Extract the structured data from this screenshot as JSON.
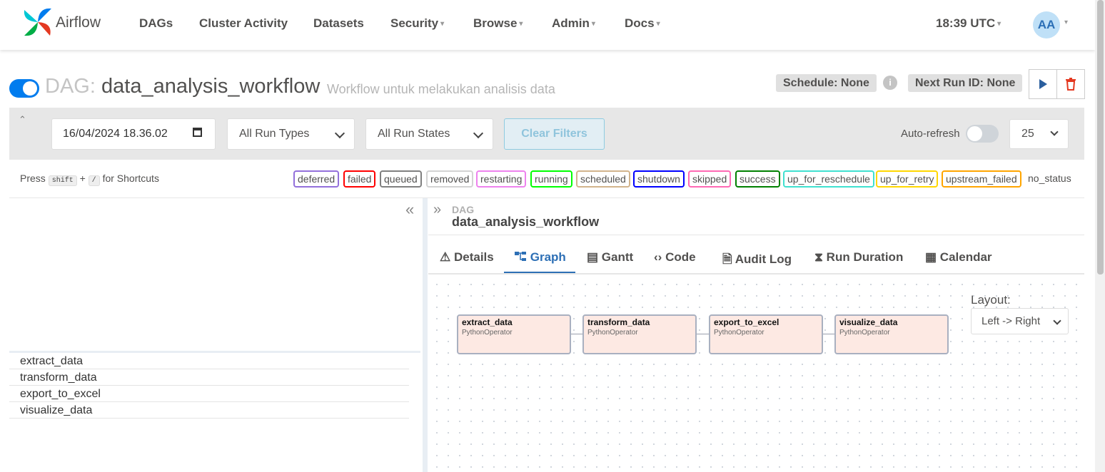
{
  "nav": {
    "brand": "Airflow",
    "items": [
      "DAGs",
      "Cluster Activity",
      "Datasets",
      "Security",
      "Browse",
      "Admin",
      "Docs"
    ],
    "time": "18:39 UTC",
    "avatar": "AA"
  },
  "dag": {
    "label": "DAG:",
    "name": "data_analysis_workflow",
    "description": "Workflow untuk melakukan analisis data",
    "schedule": "Schedule: None",
    "next_run": "Next Run ID: None",
    "paused": false
  },
  "filters": {
    "date": "16/04/2024 18.36.02",
    "run_types": "All Run Types",
    "run_states": "All Run States",
    "clear": "Clear Filters",
    "auto_refresh": "Auto-refresh",
    "page_size": "25"
  },
  "shortcuts": {
    "press": "Press",
    "key1": "shift",
    "plus": "+",
    "key2": "/",
    "suffix": "for Shortcuts"
  },
  "states": [
    {
      "label": "deferred",
      "color": "#9370db"
    },
    {
      "label": "failed",
      "color": "#ff0000"
    },
    {
      "label": "queued",
      "color": "#808080"
    },
    {
      "label": "removed",
      "color": "#d3d3d3"
    },
    {
      "label": "restarting",
      "color": "#ee82ee"
    },
    {
      "label": "running",
      "color": "#00ff00"
    },
    {
      "label": "scheduled",
      "color": "#d2b48c"
    },
    {
      "label": "shutdown",
      "color": "#0000ff"
    },
    {
      "label": "skipped",
      "color": "#ff69b4"
    },
    {
      "label": "success",
      "color": "#008000"
    },
    {
      "label": "up_for_reschedule",
      "color": "#40e0d0"
    },
    {
      "label": "up_for_retry",
      "color": "#ffd700"
    },
    {
      "label": "upstream_failed",
      "color": "#ffa500"
    },
    {
      "label": "no_status",
      "color": ""
    }
  ],
  "tasks": [
    "extract_data",
    "transform_data",
    "export_to_excel",
    "visualize_data"
  ],
  "breadcrumb": {
    "small": "DAG",
    "name": "data_analysis_workflow"
  },
  "tabs": [
    "Details",
    "Graph",
    "Gantt",
    "Code",
    "Audit Log",
    "Run Duration",
    "Calendar"
  ],
  "active_tab": "Graph",
  "graph": {
    "nodes": [
      {
        "name": "extract_data",
        "operator": "PythonOperator"
      },
      {
        "name": "transform_data",
        "operator": "PythonOperator"
      },
      {
        "name": "export_to_excel",
        "operator": "PythonOperator"
      },
      {
        "name": "visualize_data",
        "operator": "PythonOperator"
      }
    ],
    "layout_label": "Layout:",
    "layout_value": "Left -> Right"
  }
}
